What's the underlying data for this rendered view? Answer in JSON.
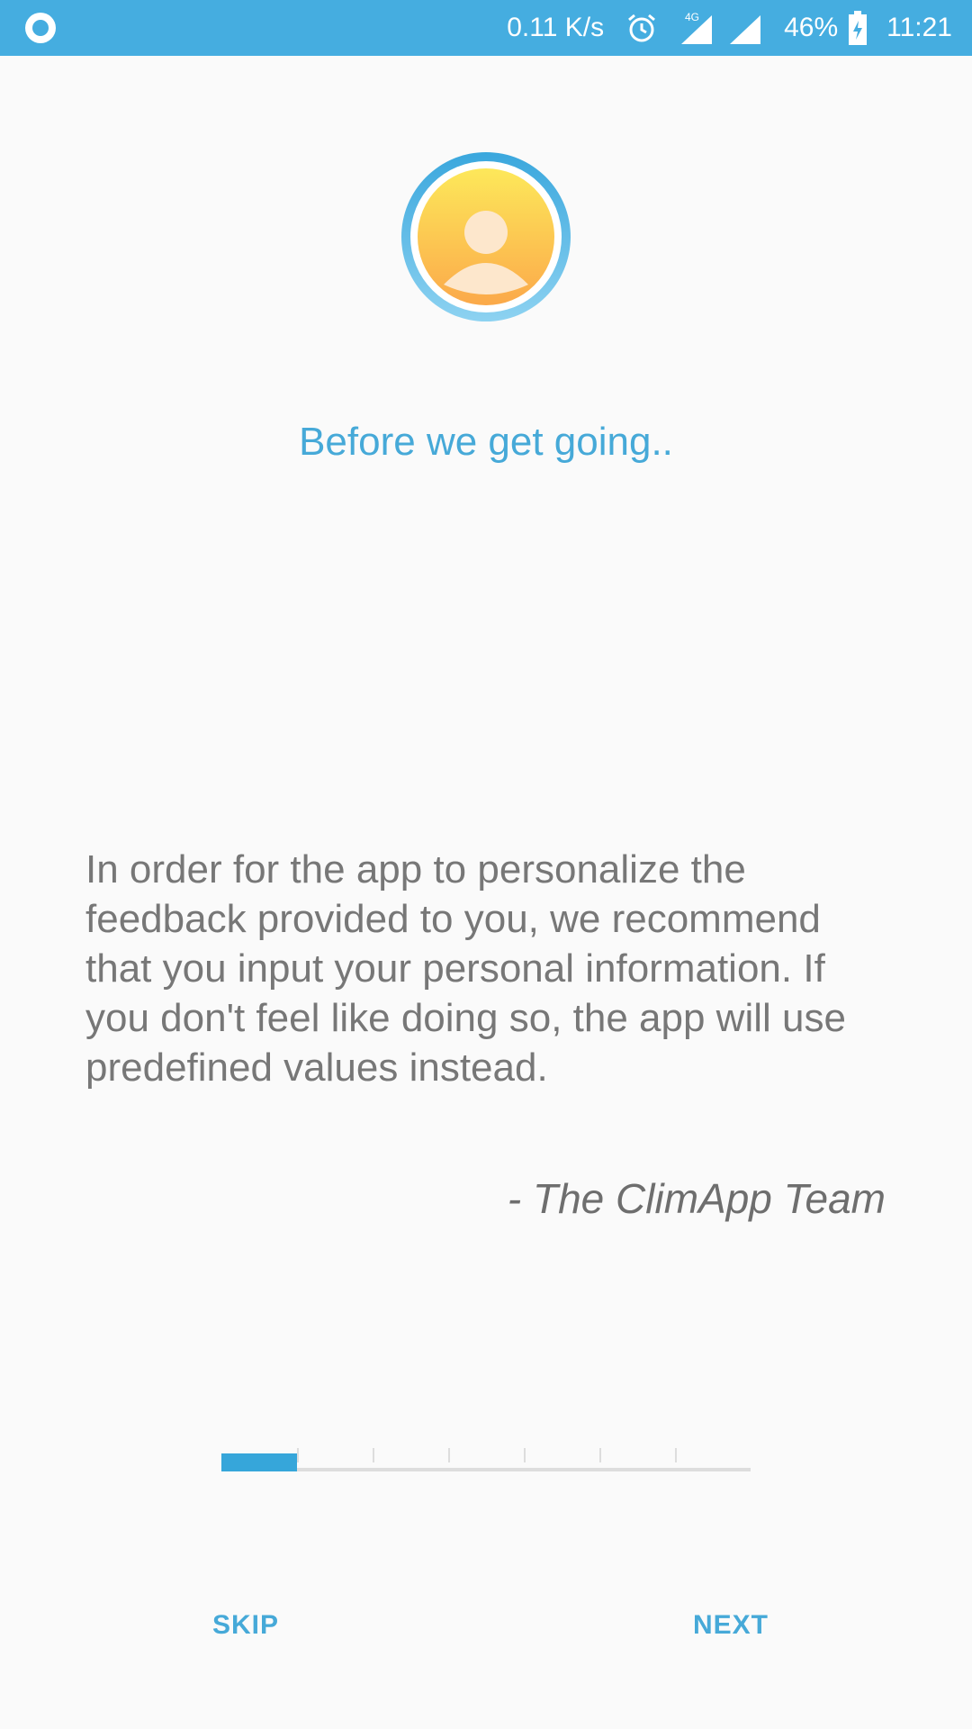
{
  "status_bar": {
    "net_speed": "0.11 K/s",
    "network_type": "4G",
    "battery_percent": "46%",
    "time": "11:21",
    "bar_color": "#45ade0"
  },
  "icons": {
    "app_notification": "circle-dot-icon",
    "alarm": "alarm-clock-icon",
    "signal_1": "cell-signal-icon",
    "signal_2": "cell-signal-icon",
    "battery": "battery-charging-icon",
    "logo": "user-avatar-icon"
  },
  "main": {
    "title": "Before we get going..",
    "body": "In order for the app to personalize the feedback provided to you, we recommend that you input your personal information. If you don't feel like doing so, the app will use predefined values instead.",
    "signature": "- The ClimApp Team"
  },
  "progress": {
    "current_step": 1,
    "total_steps": 7,
    "fill_color": "#36a6da"
  },
  "footer": {
    "skip_label": "SKIP",
    "next_label": "NEXT"
  },
  "colors": {
    "accent": "#46a9d8",
    "body_text": "#777777",
    "background": "#fafafa"
  }
}
